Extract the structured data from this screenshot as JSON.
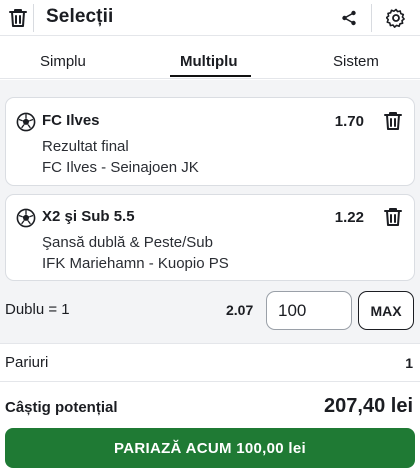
{
  "header": {
    "title": "Selecții",
    "icons": [
      "trash-icon",
      "share-icon",
      "gear-icon"
    ]
  },
  "tabs": [
    {
      "label": "Simplu",
      "active": false
    },
    {
      "label": "Multiplu",
      "active": true
    },
    {
      "label": "Sistem",
      "active": false
    }
  ],
  "selections": [
    {
      "name": "FC Ilves",
      "odds": "1.70",
      "market": "Rezultat final",
      "event": "FC Ilves - Seinajoen JK"
    },
    {
      "name": "X2 şi Sub 5.5",
      "odds": "1.22",
      "market": "Şansă dublă & Peste/Sub",
      "event": "IFK Mariehamn - Kuopio PS"
    }
  ],
  "stake": {
    "label": "Dublu = 1",
    "total_odds": "2.07",
    "amount": "100",
    "max_label": "MAX"
  },
  "summary": {
    "bets_label": "Pariuri",
    "bets_value": "1",
    "win_label": "Câștig potențial",
    "win_value": "207,40 lei"
  },
  "cta_label": "PARIAZĂ ACUM 100,00 lei",
  "colors": {
    "accent_green": "#1f7a34",
    "panel_bg": "#f3f4f6",
    "text": "#1b1d22"
  }
}
